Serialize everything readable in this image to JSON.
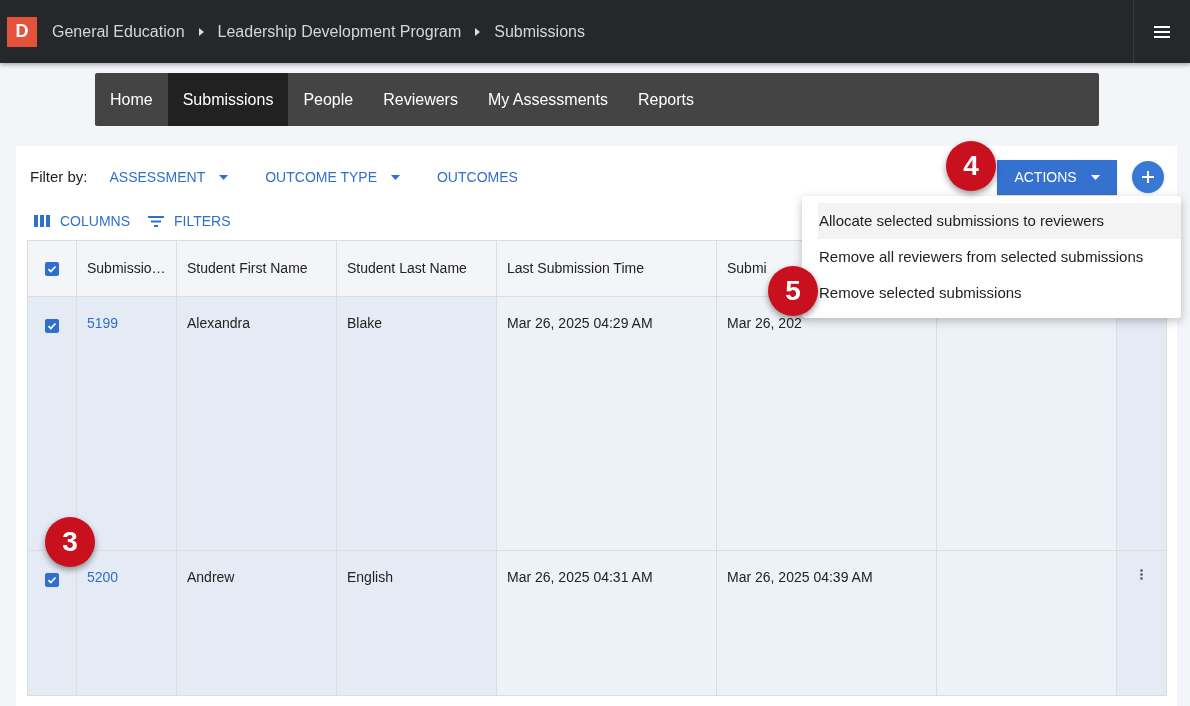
{
  "topbar": {
    "logo": "D",
    "breadcrumbs": [
      "General Education",
      "Leadership Development Program",
      "Submissions"
    ]
  },
  "nav": [
    {
      "label": "Home",
      "selected": false
    },
    {
      "label": "Submissions",
      "selected": true
    },
    {
      "label": "People",
      "selected": false
    },
    {
      "label": "Reviewers",
      "selected": false
    },
    {
      "label": "My Assessments",
      "selected": false
    },
    {
      "label": "Reports",
      "selected": false
    }
  ],
  "filter_bar": {
    "label": "Filter by:",
    "filters": [
      {
        "label": "ASSESSMENT",
        "dropdown": true
      },
      {
        "label": "OUTCOME TYPE",
        "dropdown": true
      },
      {
        "label": "OUTCOMES",
        "dropdown": false
      }
    ]
  },
  "toolbar": {
    "columns": "COLUMNS",
    "filters": "FILTERS",
    "actions": "ACTIONS"
  },
  "table": {
    "all_checked": true,
    "columns": [
      "Submissio…",
      "Student First Name",
      "Student Last Name",
      "Last Submission Time",
      "Submi"
    ],
    "rows": [
      {
        "selected": true,
        "id": "5199",
        "first": "Alexandra",
        "last": "Blake",
        "last_time": "Mar 26, 2025 04:29 AM",
        "time": "Mar 26, 202"
      },
      {
        "selected": true,
        "id": "5200",
        "first": "Andrew",
        "last": "English",
        "last_time": "Mar 26, 2025 04:31 AM",
        "time": "Mar 26, 2025 04:39 AM"
      }
    ]
  },
  "actions_menu": [
    {
      "label": "Allocate selected submissions to reviewers",
      "selected": true
    },
    {
      "label": "Remove all reviewers from selected submissions",
      "selected": false
    },
    {
      "label": "Remove selected submissions",
      "selected": false
    }
  ],
  "annotations": [
    "3",
    "4",
    "5"
  ]
}
